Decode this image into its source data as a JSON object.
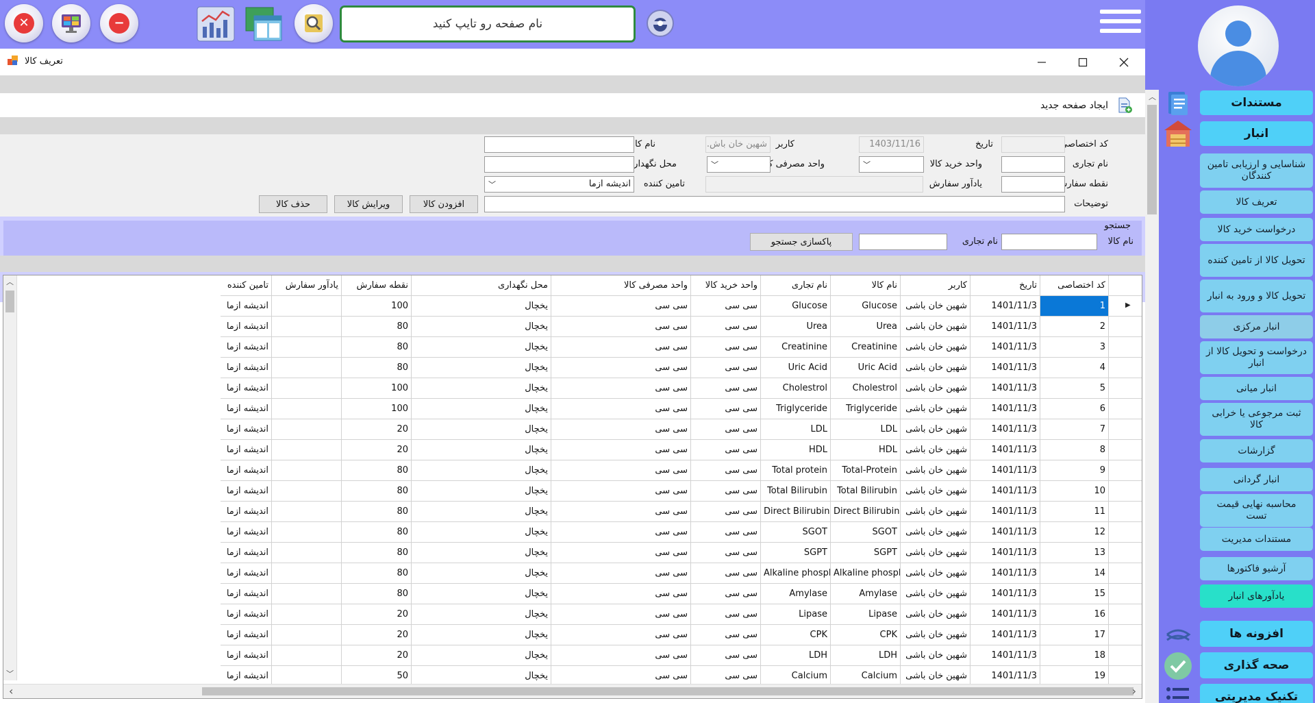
{
  "topbar": {
    "search_placeholder": "نام صفحه رو تایپ کنید",
    "accent_color": "#8c8cf8"
  },
  "window": {
    "title": "تعریف کالا",
    "new_page_label": "ایجاد صفحه جدید"
  },
  "sidebar": {
    "items": [
      {
        "label": "مستندات",
        "kind": "main"
      },
      {
        "label": "انبار",
        "kind": "main"
      },
      {
        "label": "شناسایی و ارزیابی تامین کنندگان",
        "kind": "sub"
      },
      {
        "label": "تعریف کالا",
        "kind": "sub"
      },
      {
        "label": "درخواست خرید کالا",
        "kind": "sub"
      },
      {
        "label": "تحویل کالا از تامین کننده",
        "kind": "sub"
      },
      {
        "label": "تحویل کالا و ورود به انبار",
        "kind": "sub"
      },
      {
        "label": "انبار مرکزی",
        "kind": "active"
      },
      {
        "label": "درخواست و تحویل کالا از انبار",
        "kind": "sub"
      },
      {
        "label": "انبار میانی",
        "kind": "sub"
      },
      {
        "label": "ثبت مرجوعی یا خرابی کالا",
        "kind": "sub"
      },
      {
        "label": "گزارشات",
        "kind": "sub"
      },
      {
        "label": "انبار گردانی",
        "kind": "sub"
      },
      {
        "label": "محاسبه نهایی قیمت تست",
        "kind": "sub"
      },
      {
        "label": "مستندات مدیریت",
        "kind": "sub"
      },
      {
        "label": "آرشیو فاکتورها",
        "kind": "sub"
      },
      {
        "label": "یادآورهای انبار",
        "kind": "teal"
      },
      {
        "label": "افزونه ها",
        "kind": "main"
      },
      {
        "label": "صحه گذاری",
        "kind": "main"
      },
      {
        "label": "تکنیک مدیریتی",
        "kind": "main"
      }
    ]
  },
  "form": {
    "code_label": "کد اختصاصی",
    "code_value": "",
    "date_label": "تاریخ",
    "date_value": "1403/11/16",
    "user_label": "کاربر",
    "user_value": "شهین خان باش...",
    "product_name_label": "نام کالا",
    "product_name_value": "",
    "trade_name_label": "نام تجاری",
    "trade_name_value": "",
    "purchase_unit_label": "واحد خرید کالا",
    "purchase_unit_value": "",
    "consumption_unit_label": "واحد مصرفی کالا",
    "consumption_unit_value": "",
    "storage_label": "محل نگهداری",
    "storage_value": "",
    "order_point_label": "نقطه سفارش",
    "order_point_value": "",
    "order_reminder_label": "یادآور سفارش",
    "order_reminder_value": "",
    "supplier_label": "تامین کننده",
    "supplier_value": "اندیشه ازما",
    "description_label": "توضیحات",
    "description_value": "",
    "add_button": "افزودن کالا",
    "edit_button": "ویرایش کالا",
    "delete_button": "حذف کالا"
  },
  "search": {
    "title": "جستجو",
    "product_name_label": "نام کالا",
    "trade_name_label": "نام تجاری",
    "clear_button": "پاکسازی جستجو"
  },
  "table": {
    "columns": [
      "کد اختصاصی",
      "تاریخ",
      "کاربر",
      "نام کالا",
      "نام تجاری",
      "واحد خرید کالا",
      "واحد مصرفی کالا",
      "محل نگهداری",
      "نقطه سفارش",
      "یادآور سفارش",
      "تامین کننده"
    ],
    "rows": [
      {
        "code": "1",
        "date": "1401/11/3",
        "user": "شهین خان باشی",
        "name": "Glucose",
        "trade": "Glucose",
        "punit": "سی سی",
        "cunit": "سی سی",
        "storage": "یخچال",
        "order_point": "100",
        "reminder": "",
        "supplier": "اندیشه ازما"
      },
      {
        "code": "2",
        "date": "1401/11/3",
        "user": "شهین خان باشی",
        "name": "Urea",
        "trade": "Urea",
        "punit": "سی سی",
        "cunit": "سی سی",
        "storage": "یخچال",
        "order_point": "80",
        "reminder": "",
        "supplier": "اندیشه ازما"
      },
      {
        "code": "3",
        "date": "1401/11/3",
        "user": "شهین خان باشی",
        "name": "Creatinine",
        "trade": "Creatinine",
        "punit": "سی سی",
        "cunit": "سی سی",
        "storage": "یخچال",
        "order_point": "80",
        "reminder": "",
        "supplier": "اندیشه ازما"
      },
      {
        "code": "4",
        "date": "1401/11/3",
        "user": "شهین خان باشی",
        "name": "Uric Acid",
        "trade": "Uric Acid",
        "punit": "سی سی",
        "cunit": "سی سی",
        "storage": "یخچال",
        "order_point": "80",
        "reminder": "",
        "supplier": "اندیشه ازما"
      },
      {
        "code": "5",
        "date": "1401/11/3",
        "user": "شهین خان باشی",
        "name": "Cholestrol",
        "trade": "Cholestrol",
        "punit": "سی سی",
        "cunit": "سی سی",
        "storage": "یخچال",
        "order_point": "100",
        "reminder": "",
        "supplier": "اندیشه ازما"
      },
      {
        "code": "6",
        "date": "1401/11/3",
        "user": "شهین خان باشی",
        "name": "Triglyceride",
        "trade": "Triglyceride",
        "punit": "سی سی",
        "cunit": "سی سی",
        "storage": "یخچال",
        "order_point": "100",
        "reminder": "",
        "supplier": "اندیشه ازما"
      },
      {
        "code": "7",
        "date": "1401/11/3",
        "user": "شهین خان باشی",
        "name": "LDL",
        "trade": "LDL",
        "punit": "سی سی",
        "cunit": "سی سی",
        "storage": "یخچال",
        "order_point": "20",
        "reminder": "",
        "supplier": "اندیشه ازما"
      },
      {
        "code": "8",
        "date": "1401/11/3",
        "user": "شهین خان باشی",
        "name": "HDL",
        "trade": "HDL",
        "punit": "سی سی",
        "cunit": "سی سی",
        "storage": "یخچال",
        "order_point": "20",
        "reminder": "",
        "supplier": "اندیشه ازما"
      },
      {
        "code": "9",
        "date": "1401/11/3",
        "user": "شهین خان باشی",
        "name": "Total-Protein",
        "trade": "Total protein",
        "punit": "سی سی",
        "cunit": "سی سی",
        "storage": "یخچال",
        "order_point": "80",
        "reminder": "",
        "supplier": "اندیشه ازما"
      },
      {
        "code": "10",
        "date": "1401/11/3",
        "user": "شهین خان باشی",
        "name": "Total Bilirubin",
        "trade": "Total Bilirubin",
        "punit": "سی سی",
        "cunit": "سی سی",
        "storage": "یخچال",
        "order_point": "80",
        "reminder": "",
        "supplier": "اندیشه ازما"
      },
      {
        "code": "11",
        "date": "1401/11/3",
        "user": "شهین خان باشی",
        "name": "Direct Bilirubin",
        "trade": "Direct Bilirubin",
        "punit": "سی سی",
        "cunit": "سی سی",
        "storage": "یخچال",
        "order_point": "80",
        "reminder": "",
        "supplier": "اندیشه ازما"
      },
      {
        "code": "12",
        "date": "1401/11/3",
        "user": "شهین خان باشی",
        "name": "SGOT",
        "trade": "SGOT",
        "punit": "سی سی",
        "cunit": "سی سی",
        "storage": "یخچال",
        "order_point": "80",
        "reminder": "",
        "supplier": "اندیشه ازما"
      },
      {
        "code": "13",
        "date": "1401/11/3",
        "user": "شهین خان باشی",
        "name": "SGPT",
        "trade": "SGPT",
        "punit": "سی سی",
        "cunit": "سی سی",
        "storage": "یخچال",
        "order_point": "80",
        "reminder": "",
        "supplier": "اندیشه ازما"
      },
      {
        "code": "14",
        "date": "1401/11/3",
        "user": "شهین خان باشی",
        "name": "Alkaline phosphate",
        "trade": "Alkaline phosphate",
        "punit": "سی سی",
        "cunit": "سی سی",
        "storage": "یخچال",
        "order_point": "80",
        "reminder": "",
        "supplier": "اندیشه ازما"
      },
      {
        "code": "15",
        "date": "1401/11/3",
        "user": "شهین خان باشی",
        "name": "Amylase",
        "trade": "Amylase",
        "punit": "سی سی",
        "cunit": "سی سی",
        "storage": "یخچال",
        "order_point": "80",
        "reminder": "",
        "supplier": "اندیشه ازما"
      },
      {
        "code": "16",
        "date": "1401/11/3",
        "user": "شهین خان باشی",
        "name": "Lipase",
        "trade": "Lipase",
        "punit": "سی سی",
        "cunit": "سی سی",
        "storage": "یخچال",
        "order_point": "20",
        "reminder": "",
        "supplier": "اندیشه ازما"
      },
      {
        "code": "17",
        "date": "1401/11/3",
        "user": "شهین خان باشی",
        "name": "CPK",
        "trade": "CPK",
        "punit": "سی سی",
        "cunit": "سی سی",
        "storage": "یخچال",
        "order_point": "20",
        "reminder": "",
        "supplier": "اندیشه ازما"
      },
      {
        "code": "18",
        "date": "1401/11/3",
        "user": "شهین خان باشی",
        "name": "LDH",
        "trade": "LDH",
        "punit": "سی سی",
        "cunit": "سی سی",
        "storage": "یخچال",
        "order_point": "20",
        "reminder": "",
        "supplier": "اندیشه ازما"
      },
      {
        "code": "19",
        "date": "1401/11/3",
        "user": "شهین خان باشی",
        "name": "Calcium",
        "trade": "Calcium",
        "punit": "سی سی",
        "cunit": "سی سی",
        "storage": "یخچال",
        "order_point": "50",
        "reminder": "",
        "supplier": "اندیشه ازما"
      }
    ]
  }
}
